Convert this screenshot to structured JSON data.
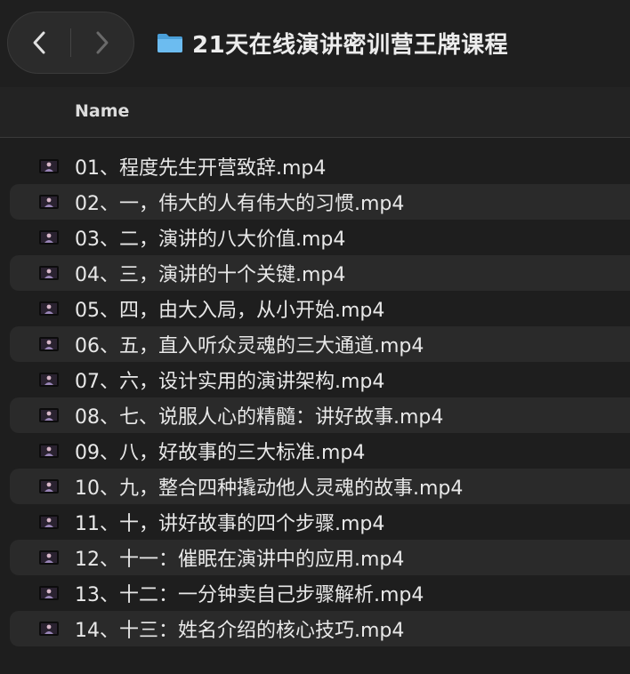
{
  "window": {
    "title": "21天在线演讲密训营王牌课程",
    "folder_icon": "folder-icon",
    "back_icon": "chevron-left-icon",
    "forward_icon": "chevron-right-icon"
  },
  "columns": {
    "name": "Name"
  },
  "files": [
    {
      "name": "01、程度先生开营致辞.mp4",
      "icon": "video-thumbnail-icon"
    },
    {
      "name": "02、一，伟大的人有伟大的习惯.mp4",
      "icon": "video-thumbnail-icon"
    },
    {
      "name": "03、二，演讲的八大价值.mp4",
      "icon": "video-thumbnail-icon"
    },
    {
      "name": "04、三，演讲的十个关键.mp4",
      "icon": "video-thumbnail-icon"
    },
    {
      "name": "05、四，由大入局，从小开始.mp4",
      "icon": "video-thumbnail-icon"
    },
    {
      "name": "06、五，直入听众灵魂的三大通道.mp4",
      "icon": "video-thumbnail-icon"
    },
    {
      "name": "07、六，设计实用的演讲架构.mp4",
      "icon": "video-thumbnail-icon"
    },
    {
      "name": "08、七、说服人心的精髓：讲好故事.mp4",
      "icon": "video-thumbnail-icon"
    },
    {
      "name": "09、八，好故事的三大标准.mp4",
      "icon": "video-thumbnail-icon"
    },
    {
      "name": "10、九，整合四种撬动他人灵魂的故事.mp4",
      "icon": "video-thumbnail-icon"
    },
    {
      "name": "11、十，讲好故事的四个步骤.mp4",
      "icon": "video-thumbnail-icon"
    },
    {
      "name": "12、十一：催眠在演讲中的应用.mp4",
      "icon": "video-thumbnail-icon"
    },
    {
      "name": "13、十二：一分钟卖自己步骤解析.mp4",
      "icon": "video-thumbnail-icon"
    },
    {
      "name": "14、十三：姓名介绍的核心技巧.mp4",
      "icon": "video-thumbnail-icon"
    }
  ],
  "colors": {
    "background": "#1e1e1e",
    "alt_row": "#2a2a2a",
    "folder": "#5aaee8"
  }
}
